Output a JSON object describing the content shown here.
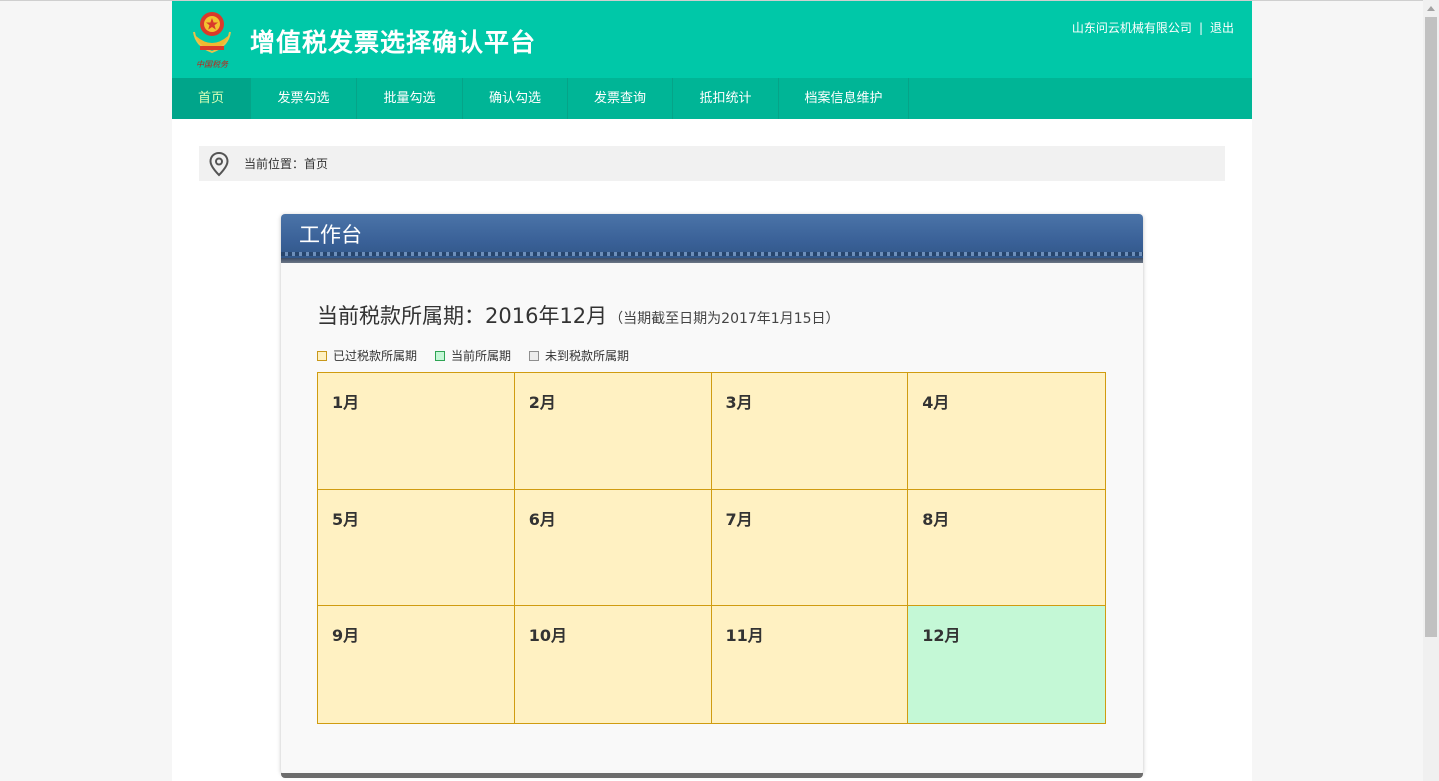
{
  "header": {
    "title": "增值税发票选择确认平台",
    "company": "山东问云机械有限公司",
    "separator": "|",
    "logout": "退出",
    "emblem_text": "中国税务"
  },
  "nav": {
    "items": [
      {
        "label": "首页",
        "active": true
      },
      {
        "label": "发票勾选"
      },
      {
        "label": "批量勾选"
      },
      {
        "label": "确认勾选"
      },
      {
        "label": "发票查询"
      },
      {
        "label": "抵扣统计"
      },
      {
        "label": "档案信息维护"
      }
    ]
  },
  "breadcrumb": {
    "text": "当前位置：首页",
    "icon": "location-pin-icon"
  },
  "workbench": {
    "title": "工作台",
    "period_main": "当前税款所属期：2016年12月",
    "period_note": "（当期截至日期为2017年1月15日）",
    "legend": [
      {
        "label": "已过税款所属期",
        "color": "#fff1c2"
      },
      {
        "label": "当前所属期",
        "color": "#c4f8d6"
      },
      {
        "label": "未到税款所属期",
        "color": "#ececec"
      }
    ],
    "months": [
      {
        "label": "1月",
        "status": "past"
      },
      {
        "label": "2月",
        "status": "past"
      },
      {
        "label": "3月",
        "status": "past"
      },
      {
        "label": "4月",
        "status": "past"
      },
      {
        "label": "5月",
        "status": "past"
      },
      {
        "label": "6月",
        "status": "past"
      },
      {
        "label": "7月",
        "status": "past"
      },
      {
        "label": "8月",
        "status": "past"
      },
      {
        "label": "9月",
        "status": "past"
      },
      {
        "label": "10月",
        "status": "past"
      },
      {
        "label": "11月",
        "status": "past"
      },
      {
        "label": "12月",
        "status": "current"
      }
    ]
  },
  "colors": {
    "header": "#00c8a8",
    "nav": "#00b596",
    "card_header": "#3a6198",
    "past": "#fff1c2",
    "current": "#c4f8d6",
    "future": "#ececec"
  }
}
